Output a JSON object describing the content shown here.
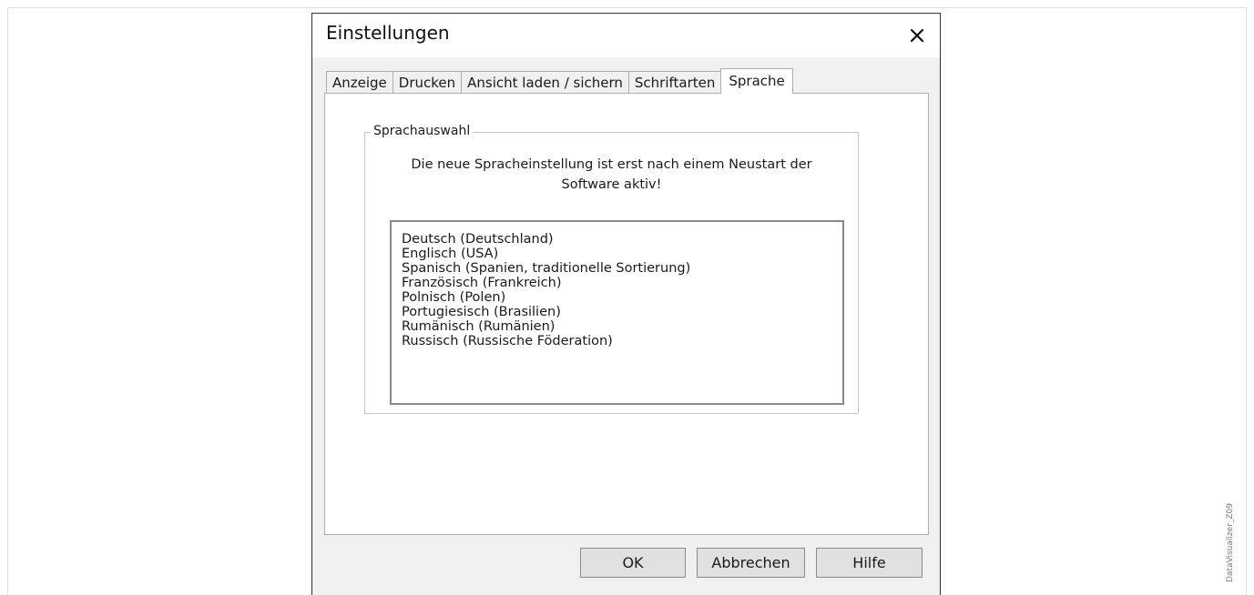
{
  "dialog": {
    "title": "Einstellungen",
    "close_icon": "close-icon"
  },
  "tabs": [
    {
      "label": "Anzeige"
    },
    {
      "label": "Drucken"
    },
    {
      "label": "Ansicht laden / sichern"
    },
    {
      "label": "Schriftarten"
    },
    {
      "label": "Sprache",
      "active": true
    }
  ],
  "language_group": {
    "legend": "Sprachauswahl",
    "notice_line1": "Die neue Spracheinstellung ist erst nach einem Neustart der",
    "notice_line2": "Software aktiv!",
    "languages": [
      "Deutsch (Deutschland)",
      "Englisch (USA)",
      "Spanisch (Spanien, traditionelle Sortierung)",
      "Französisch (Frankreich)",
      "Polnisch (Polen)",
      "Portugiesisch (Brasilien)",
      "Rumänisch (Rumänien)",
      "Russisch (Russische Föderation)"
    ]
  },
  "buttons": {
    "ok": "OK",
    "cancel": "Abbrechen",
    "help": "Hilfe"
  },
  "side_caption": "DataVisualizer_Z09"
}
